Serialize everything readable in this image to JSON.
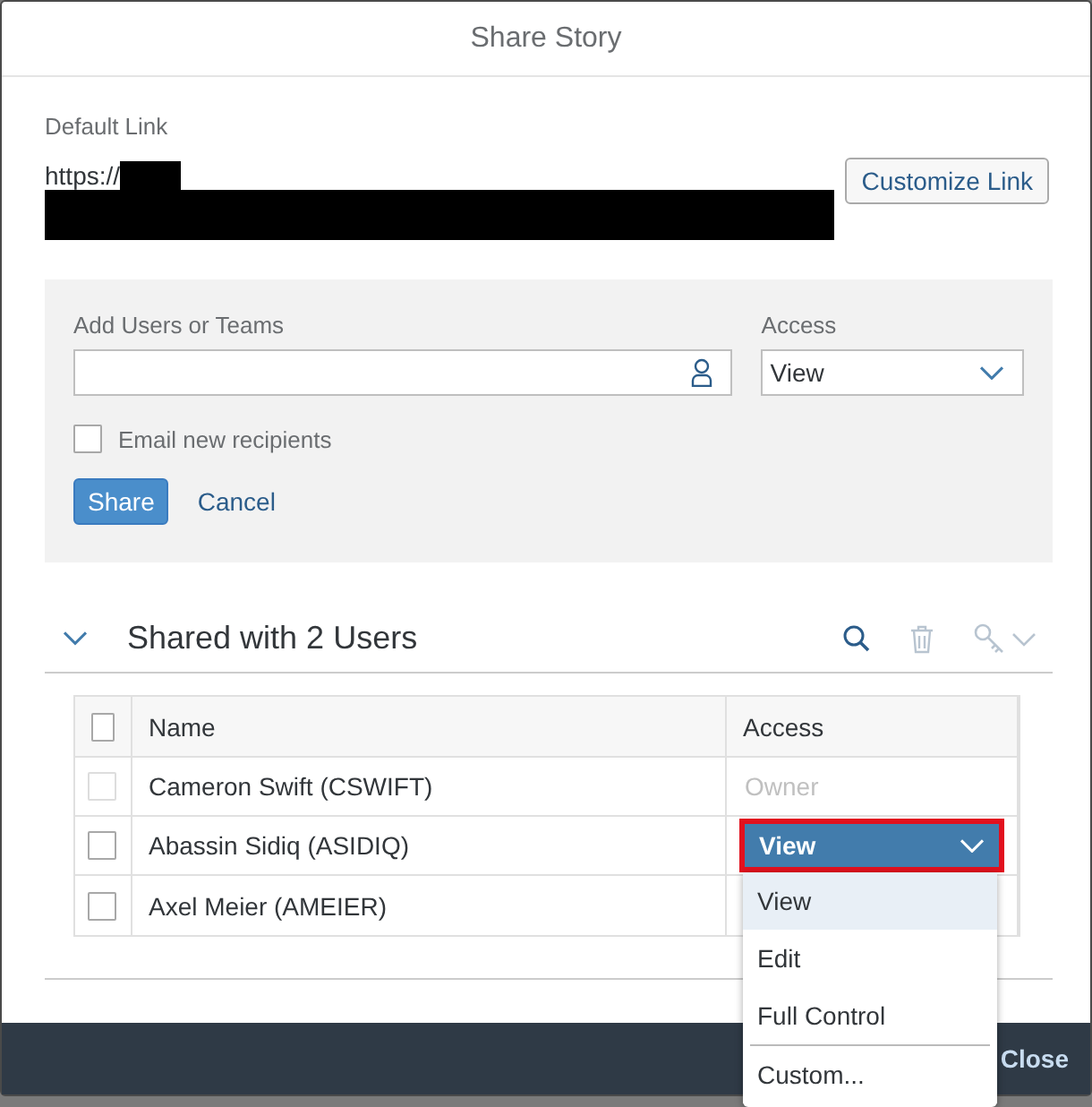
{
  "dialog": {
    "title": "Share Story"
  },
  "default_link": {
    "label": "Default Link",
    "url": "https://",
    "customize_button": "Customize Link"
  },
  "add_panel": {
    "users_label": "Add Users or Teams",
    "access_label": "Access",
    "access_value": "View",
    "email_checkbox": {
      "label": "Email new recipients",
      "checked": false
    },
    "buttons": [
      {
        "label": "Share",
        "kind": "primary"
      },
      {
        "label": "Cancel",
        "kind": "link"
      }
    ]
  },
  "shared": {
    "title": "Shared with 2 Users",
    "expanded": true,
    "columns": [
      "Name",
      "Access"
    ],
    "header_checked": false,
    "rows": [
      {
        "name": "Cameron Swift (CSWIFT)",
        "access": "Owner",
        "kind": "owner",
        "checked": false,
        "disabled": true
      },
      {
        "name": "Abassin Sidiq (ASIDIQ)",
        "access": "View",
        "kind": "select",
        "checked": false,
        "disabled": false,
        "open": true,
        "highlighted": true
      },
      {
        "name": "Axel Meier (AMEIER)",
        "kind": "hidden",
        "checked": false,
        "disabled": false
      }
    ]
  },
  "access_menu": {
    "options": [
      {
        "label": "View",
        "selected": true
      },
      {
        "label": "Edit",
        "selected": false
      },
      {
        "label": "Full Control",
        "selected": false
      },
      {
        "label": "Custom...",
        "selected": false,
        "separated": true
      }
    ]
  },
  "footer": {
    "close": "Close"
  }
}
